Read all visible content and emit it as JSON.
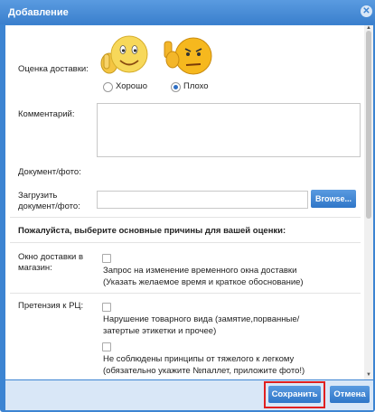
{
  "dialog": {
    "title": "Добавление",
    "close_icon": "close-icon"
  },
  "form": {
    "delivery_rating_label": "Оценка доставки:",
    "rating_good_label": "Хорошо",
    "rating_bad_label": "Плохо",
    "rating_selected": "bad",
    "comment_label": "Комментарий:",
    "document_label": "Документ/фото:",
    "upload_label_line1": "Загрузить",
    "upload_label_line2": "документ/фото:",
    "browse_label": "Browse...",
    "reasons_heading": "Пожалуйста, выберите основные причины для вашей оценки:",
    "reasons": [
      {
        "group": "Окно доставки в",
        "group_line2": "магазин:",
        "option_line1": "Запрос на изменение временного окна доставки",
        "option_line2": "(Указать желаемое время и краткое обоснование)"
      },
      {
        "group": "Претензия к РЦ:",
        "option_line1": "Нарушение товарного вида (замятие,порванные/",
        "option_line2": "затертые этикетки и прочее)"
      },
      {
        "option_line1": "Не соблюдены принципы от тяжелого к легкому",
        "option_line2": "(обязательно укажите №паллет, приложите фото!)"
      }
    ]
  },
  "footer": {
    "save_label": "Сохранить",
    "cancel_label": "Отмена"
  },
  "colors": {
    "accent": "#3c84d2",
    "highlight": "#e02020"
  }
}
